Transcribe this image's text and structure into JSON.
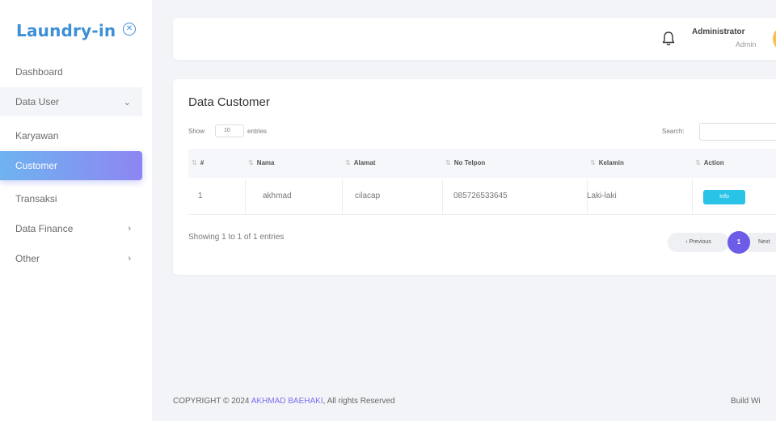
{
  "brand": {
    "name": "Laundry-in"
  },
  "sidebar": {
    "items": [
      {
        "label": "Dashboard"
      },
      {
        "label": "Data User",
        "chevron": "⌄"
      },
      {
        "label": "Karyawan"
      },
      {
        "label": "Customer"
      },
      {
        "label": "Transaksi"
      },
      {
        "label": "Data Finance",
        "chevron": "›"
      },
      {
        "label": "Other",
        "chevron": "›"
      }
    ]
  },
  "header": {
    "user_name": "Administrator",
    "user_role": "Admin"
  },
  "card": {
    "title": "Data Customer",
    "show_label": "Show",
    "show_value": "10",
    "entries_label": "entries",
    "search_label": "Search:",
    "search_value": "",
    "columns": [
      "#",
      "Nama",
      "Alamat",
      "No Telpon",
      "Kelamin",
      "Action"
    ],
    "rows": [
      {
        "no": "1",
        "nama": "akhmad",
        "alamat": "cilacap",
        "telpon": "085726533645",
        "kelamin": "Laki-laki",
        "action": "Info"
      }
    ],
    "showing_text": "Showing 1 to 1 of 1 entries",
    "prev_label": "‹ Previous",
    "current_page": "1",
    "next_label": "Next"
  },
  "footer": {
    "copyright_prefix": "COPYRIGHT © 2024",
    "author": "AKHMAD BAEHAKI",
    "suffix": ", All rights Reserved",
    "right_text": "Build Wi"
  },
  "colors": {
    "brand": "#3d8fd6",
    "active_gradient_start": "#6fb3ef",
    "active_gradient_end": "#8d86f2",
    "info_button": "#29c3e8",
    "pagination_active": "#6c5ce7"
  },
  "icons": {
    "brand_toggle": "circle-x-icon",
    "notification": "bell-icon"
  }
}
